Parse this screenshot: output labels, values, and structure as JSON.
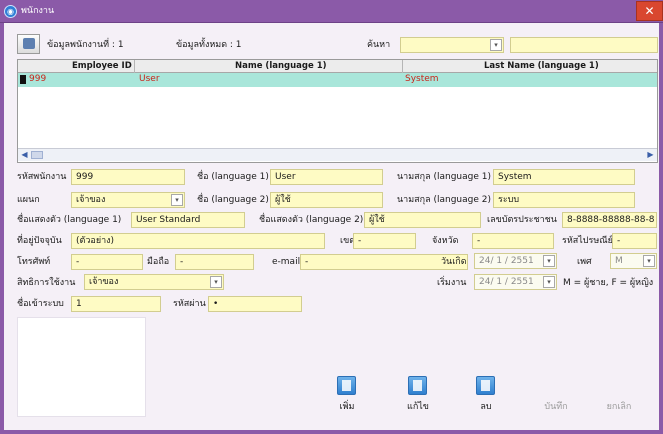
{
  "window": {
    "title": "พนักงาน",
    "close_label": "✕"
  },
  "toolbar": {
    "employee_count_label": "ข้อมูลพนักงานที่ : 1",
    "total_label": "ข้อมูลทั้งหมด : 1",
    "search_label": "ค้นหา",
    "search_field_value": "",
    "search_text_value": ""
  },
  "grid": {
    "columns": [
      "Employee ID",
      "Name (language 1)",
      "Last Name (language 1)"
    ],
    "rows": [
      {
        "employee_id": "999",
        "name": "User",
        "last_name": "System"
      }
    ]
  },
  "form": {
    "employee_code": {
      "label": "รหัสพนักงาน",
      "value": "999"
    },
    "first_name_1": {
      "label": "ชื่อ (language 1)",
      "value": "User"
    },
    "last_name_1": {
      "label": "นามสกุล (language 1)",
      "value": "System"
    },
    "department": {
      "label": "แผนก",
      "value": "เจ้าของ"
    },
    "first_name_2": {
      "label": "ชื่อ (language 2)",
      "value": "ผู้ใช้"
    },
    "last_name_2": {
      "label": "นามสกุล (language 2)",
      "value": "ระบบ"
    },
    "display_name_1": {
      "label": "ชื่อแสดงตัว (language 1)",
      "value": "User Standard"
    },
    "display_name_2": {
      "label": "ชื่อแสดงตัว (language 2)",
      "value": "ผู้ใช้"
    },
    "id_card": {
      "label": "เลขบัตรประชาชน",
      "value": "8-8888-88888-88-8"
    },
    "address": {
      "label": "ที่อยู่ปัจจุบัน",
      "value": "(ตัวอย่าง)"
    },
    "district": {
      "label": "เขต",
      "value": "-"
    },
    "province": {
      "label": "จังหวัด",
      "value": "-"
    },
    "postal_code": {
      "label": "รหัสไปรษณีย์",
      "value": "-"
    },
    "phone": {
      "label": "โทรศัพท์",
      "value": "-"
    },
    "mobile": {
      "label": "มือถือ",
      "value": "-"
    },
    "email": {
      "label": "e-mail",
      "value": "-"
    },
    "birth_date": {
      "label": "วันเกิด",
      "value": "24/ 1 / 2551"
    },
    "gender": {
      "label": "เพศ",
      "value": "M"
    },
    "access_rights": {
      "label": "สิทธิการใช้งาน",
      "value": "เจ้าของ"
    },
    "start_date": {
      "label": "เริ่มงาน",
      "value": "24/ 1 / 2551"
    },
    "gender_note": "M = ผู้ชาย, F = ผู้หญิง",
    "login": {
      "label": "ชื่อเข้าระบบ",
      "value": "1"
    },
    "password": {
      "label": "รหัสผ่าน",
      "value": "•"
    }
  },
  "actions": {
    "add": "เพิ่ม",
    "edit": "แก้ไข",
    "delete": "ลบ",
    "save": "บันทึก",
    "cancel": "ยกเลิก"
  },
  "colors": {
    "titlebar": "#8b5aa8",
    "field_bg": "#fefbc4",
    "selected_row": "#a9e6da",
    "row_text": "#c8261c"
  }
}
